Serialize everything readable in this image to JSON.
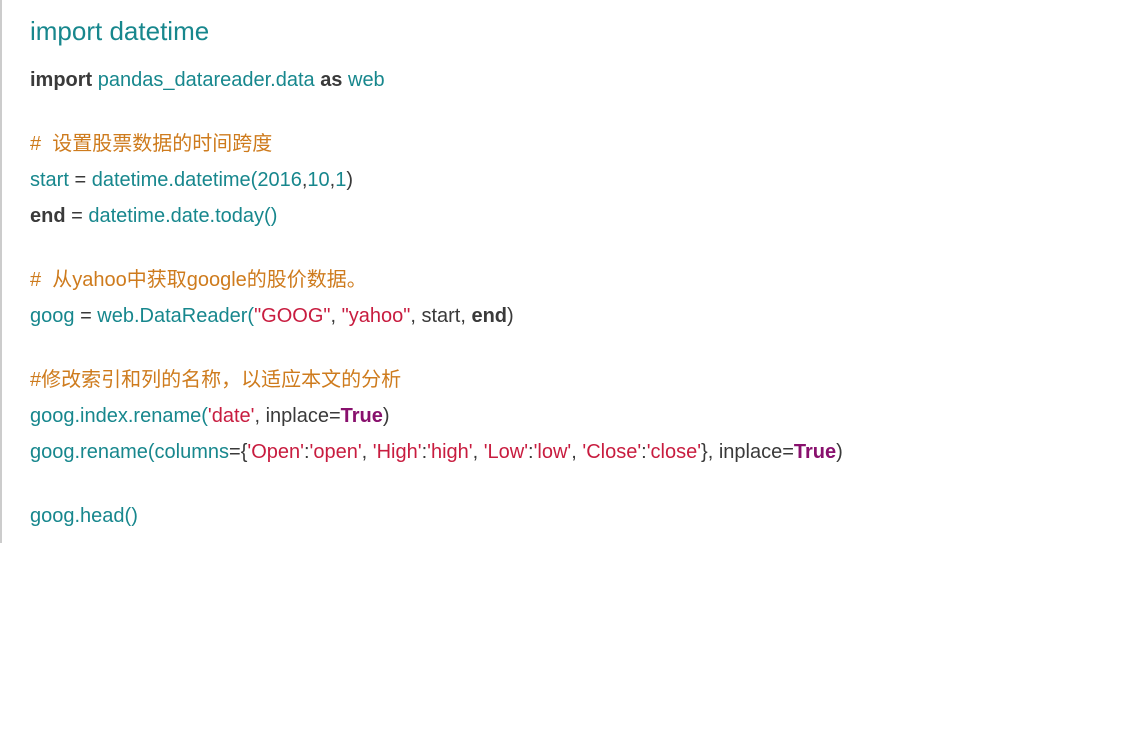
{
  "lines": {
    "l1_import": "import",
    "l1_mod": " datetime",
    "l2_import": "import",
    "l2_mod": " pandas_datareader.data ",
    "l2_as": "as",
    "l2_alias": " web",
    "c1": "#  设置股票数据的时间跨度",
    "l3_a": "start ",
    "l3_eq": "=",
    "l3_b": " datetime",
    "l3_c": ".datetime(",
    "l3_n1": "2016",
    "l3_cm1": ",",
    "l3_n2": "10",
    "l3_cm2": ",",
    "l3_n3": "1",
    "l3_d": ")",
    "l4_end": "end",
    "l4_sp": " ",
    "l4_eq": "=",
    "l4_a": " datetime",
    "l4_b": ".date.today()",
    "c2": "#  从yahoo中获取google的股价数据。",
    "l5_a": "goog ",
    "l5_eq": "=",
    "l5_b": " web",
    "l5_c": ".DataReader(",
    "l5_s1": "\"GOOG\"",
    "l5_cm1": ", ",
    "l5_s2": "\"yahoo\"",
    "l5_cm2": ", start, ",
    "l5_end": "end",
    "l5_d": ")",
    "c3": "#修改索引和列的名称，以适应本文的分析",
    "l6_a": "goog",
    "l6_b": ".index.rename(",
    "l6_s": "'date'",
    "l6_c": ", inplace",
    "l6_eq": "=",
    "l6_t": "True",
    "l6_d": ")",
    "l7_a": "goog",
    "l7_b": ".rename(columns",
    "l7_eq1": "=",
    "l7_br": "{",
    "l7_s1": "'Open'",
    "l7_col1": ":",
    "l7_s2": "'open'",
    "l7_cm1": ", ",
    "l7_s3": "'High'",
    "l7_col2": ":",
    "l7_s4": "'high'",
    "l7_cm2": ", ",
    "l7_s5": "'Low'",
    "l7_col3": ":",
    "l7_s6": "'low'",
    "l7_cm3": ", ",
    "l7_s7": "'Close'",
    "l7_col4": ":",
    "l7_s8": "'close'",
    "l7_br2": "}, inplace",
    "l7_eq2": "=",
    "l7_t": "True",
    "l7_d": ")",
    "l8_a": "goog",
    "l8_b": ".head()"
  }
}
